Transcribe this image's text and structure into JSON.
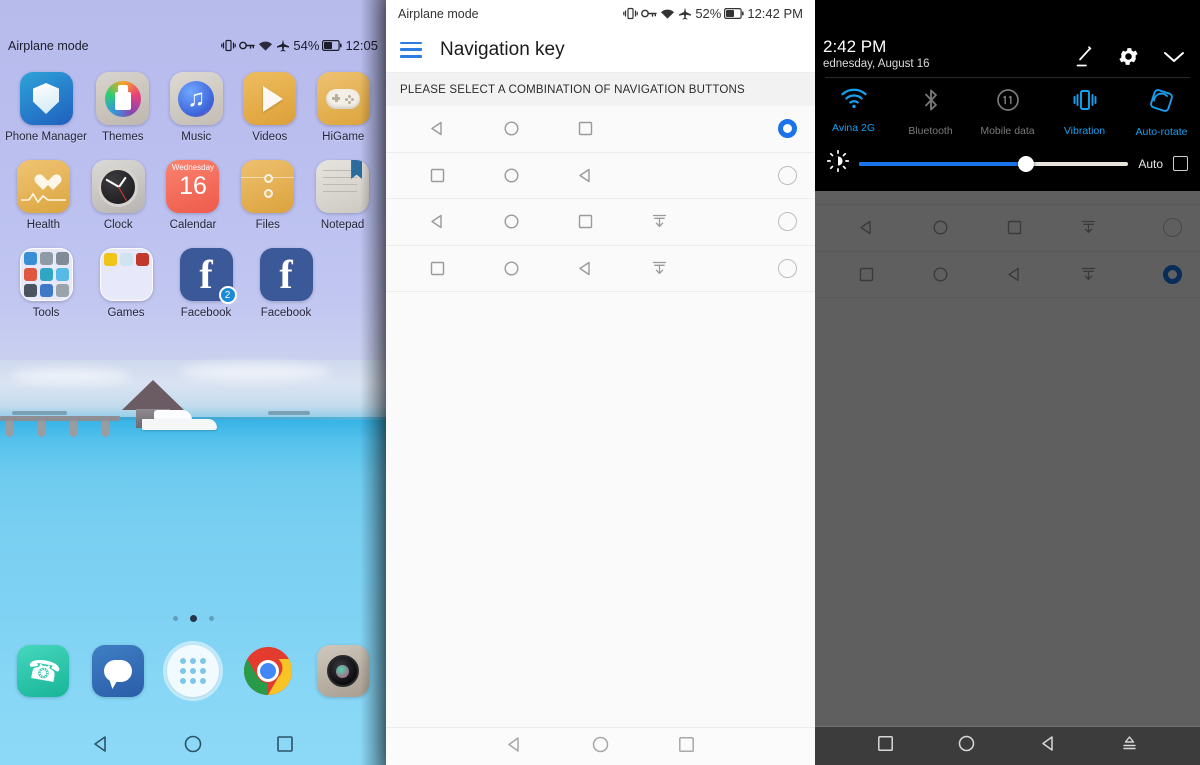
{
  "home": {
    "status": {
      "carrier_text": "Airplane mode",
      "battery_percent": "54%",
      "time": "12:05",
      "icons": [
        "vibrate-icon",
        "vpn-key-icon",
        "wifi-icon",
        "airplane-icon",
        "battery-icon"
      ]
    },
    "app_rows": [
      [
        {
          "label": "Phone Manager",
          "icon": "phone-manager-icon"
        },
        {
          "label": "Themes",
          "icon": "themes-icon"
        },
        {
          "label": "Music",
          "icon": "music-icon"
        },
        {
          "label": "Videos",
          "icon": "videos-icon"
        },
        {
          "label": "HiGame",
          "icon": "higame-icon"
        }
      ],
      [
        {
          "label": "Health",
          "icon": "health-icon"
        },
        {
          "label": "Clock",
          "icon": "clock-icon"
        },
        {
          "label": "Calendar",
          "icon": "calendar-icon"
        },
        {
          "label": "Files",
          "icon": "files-icon"
        },
        {
          "label": "Notepad",
          "icon": "notepad-icon"
        }
      ],
      [
        {
          "label": "Tools",
          "icon": "tools-folder-icon"
        },
        {
          "label": "Games",
          "icon": "games-folder-icon"
        },
        {
          "label": "Facebook",
          "icon": "facebook-icon",
          "badge": "2"
        },
        {
          "label": "Facebook",
          "icon": "facebook-icon"
        }
      ]
    ],
    "calendar_icon": {
      "weekday": "Wednesday",
      "day": "16"
    },
    "page_dots": {
      "count": 3,
      "active_index": 1
    },
    "dock": [
      {
        "label": "Phone",
        "icon": "phone-icon"
      },
      {
        "label": "Messages",
        "icon": "messages-icon"
      },
      {
        "label": "App drawer",
        "icon": "app-drawer-icon"
      },
      {
        "label": "Chrome",
        "icon": "chrome-icon"
      },
      {
        "label": "Camera",
        "icon": "camera-icon"
      }
    ],
    "navbar": [
      {
        "name": "back-button",
        "glyph": "triangle-left-icon"
      },
      {
        "name": "home-button",
        "glyph": "circle-icon"
      },
      {
        "name": "recents-button",
        "glyph": "square-icon"
      }
    ]
  },
  "nav_settings": {
    "status": {
      "carrier_text": "Airplane mode",
      "battery_percent": "52%",
      "time": "12:42 PM"
    },
    "appbar": {
      "menu_icon": "hamburger-icon",
      "title": "Navigation key"
    },
    "section_header": "PLEASE SELECT A COMBINATION OF NAVIGATION BUTTONS",
    "options": [
      {
        "keys": [
          "triangle-left-icon",
          "circle-icon",
          "square-icon"
        ],
        "selected": true
      },
      {
        "keys": [
          "square-icon",
          "circle-icon",
          "triangle-left-icon"
        ],
        "selected": false
      },
      {
        "keys": [
          "triangle-left-icon",
          "circle-icon",
          "square-icon",
          "notification-pull-icon"
        ],
        "selected": false
      },
      {
        "keys": [
          "square-icon",
          "circle-icon",
          "triangle-left-icon",
          "notification-pull-icon"
        ],
        "selected": false
      }
    ],
    "navbar": [
      {
        "name": "back-button",
        "glyph": "triangle-left-icon"
      },
      {
        "name": "home-button",
        "glyph": "circle-icon"
      },
      {
        "name": "recents-button",
        "glyph": "square-icon"
      }
    ]
  },
  "quick_settings": {
    "time": "2:42 PM",
    "date": "ednesday, August 16",
    "header_icons": [
      "edit-icon",
      "gear-icon",
      "chevron-down-icon"
    ],
    "tiles": [
      {
        "label": "Avina 2G",
        "icon": "wifi-icon",
        "state": "on"
      },
      {
        "label": "Bluetooth",
        "icon": "bluetooth-icon",
        "state": "off"
      },
      {
        "label": "Mobile data",
        "icon": "mobile-data-icon",
        "state": "off"
      },
      {
        "label": "Vibration",
        "icon": "vibration-icon",
        "state": "on"
      },
      {
        "label": "Auto-rotate",
        "icon": "auto-rotate-icon",
        "state": "on"
      }
    ],
    "brightness": {
      "icon": "brightness-icon",
      "value_percent": 62,
      "auto_label": "Auto",
      "auto_checked": false
    },
    "underlying_options": [
      {
        "keys": [
          "square-icon",
          "circle-icon",
          "triangle-left-icon"
        ],
        "selected": false
      },
      {
        "keys": [
          "triangle-left-icon",
          "circle-icon",
          "square-icon",
          "notification-pull-icon"
        ],
        "selected": false
      },
      {
        "keys": [
          "square-icon",
          "circle-icon",
          "triangle-left-icon",
          "notification-pull-icon"
        ],
        "selected": true
      }
    ],
    "navbar": [
      {
        "name": "recents-button",
        "glyph": "square-icon"
      },
      {
        "name": "home-button",
        "glyph": "circle-icon"
      },
      {
        "name": "back-button",
        "glyph": "triangle-left-icon"
      },
      {
        "name": "hide-navbar-button",
        "glyph": "notification-pull-icon"
      }
    ]
  },
  "colors": {
    "accent_blue": "#1a73e8",
    "tile_on": "#18a0f0",
    "tile_off": "#7a7a7a",
    "appbar_icon": "#2b7de0"
  }
}
